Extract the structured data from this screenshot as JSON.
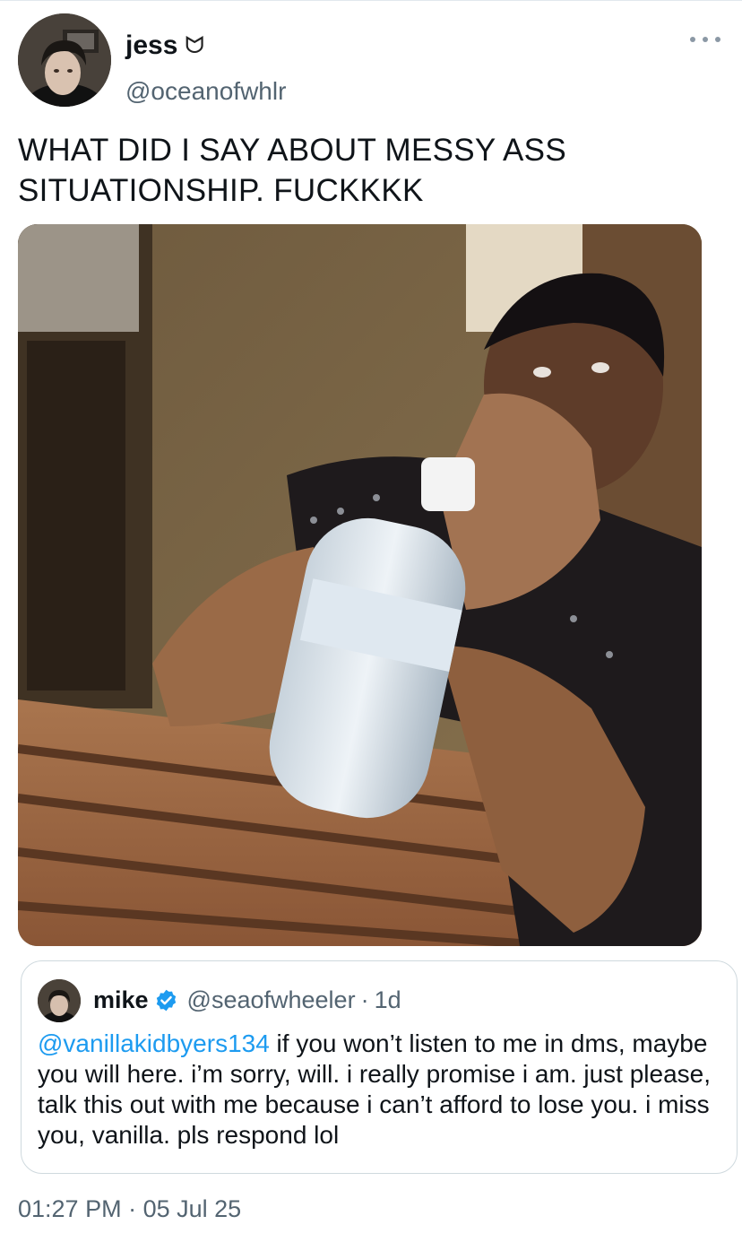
{
  "tweet": {
    "display_name": "jess",
    "name_emoji": "ᗢ",
    "handle": "@oceanofwhlr",
    "text_line1": "WHAT DID I SAY ABOUT MESSY ASS",
    "text_line2": "SITUATIONSHIP. FUCKKKK",
    "more_icon": "ellipsis-icon",
    "time": "01:27 PM",
    "separator": "·",
    "date": "05 Jul 25"
  },
  "quote": {
    "display_name": "mike",
    "verified_icon": "verified-badge-icon",
    "handle": "@seaofwheeler",
    "separator": "·",
    "age": "1d",
    "mention": "@vanillakidbyers134",
    "body": " if you won’t listen to me in dms, maybe you will here. i’m sorry, will. i really promise i am. just please, talk this out with me because i can’t afford to lose you. i miss you, vanilla. pls respond lol"
  },
  "colors": {
    "text": "#0f1419",
    "secondary": "#536471",
    "link": "#1d9bf0",
    "border": "#cfd9de"
  }
}
